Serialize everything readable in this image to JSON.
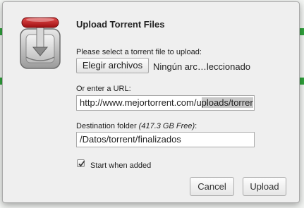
{
  "dialog": {
    "title": "Upload Torrent Files",
    "select_file_label": "Please select a torrent file to upload:",
    "choose_files_button": "Elegir archivos",
    "file_status": "Ningún arc…leccionado",
    "url_label": "Or enter a URL:",
    "url_value_prefix": "http://www.mejortorrent.com/u",
    "url_value_selected": "ploads/torrer",
    "destination_label": "Destination folder",
    "destination_free": "(417.3 GB Free)",
    "destination_suffix": ":",
    "destination_value": "/Datos/torrent/finalizados",
    "start_when_added_label": "Start when added",
    "start_when_added_checked": true,
    "cancel_button": "Cancel",
    "upload_button": "Upload"
  },
  "colors": {
    "dialog_bg": "#efefef",
    "background_strip": "#dcefdc",
    "background_edge": "#2fa33b"
  },
  "icons": {
    "app_logo": "transmission-logo-icon",
    "checkbox_mark": "check-icon"
  }
}
